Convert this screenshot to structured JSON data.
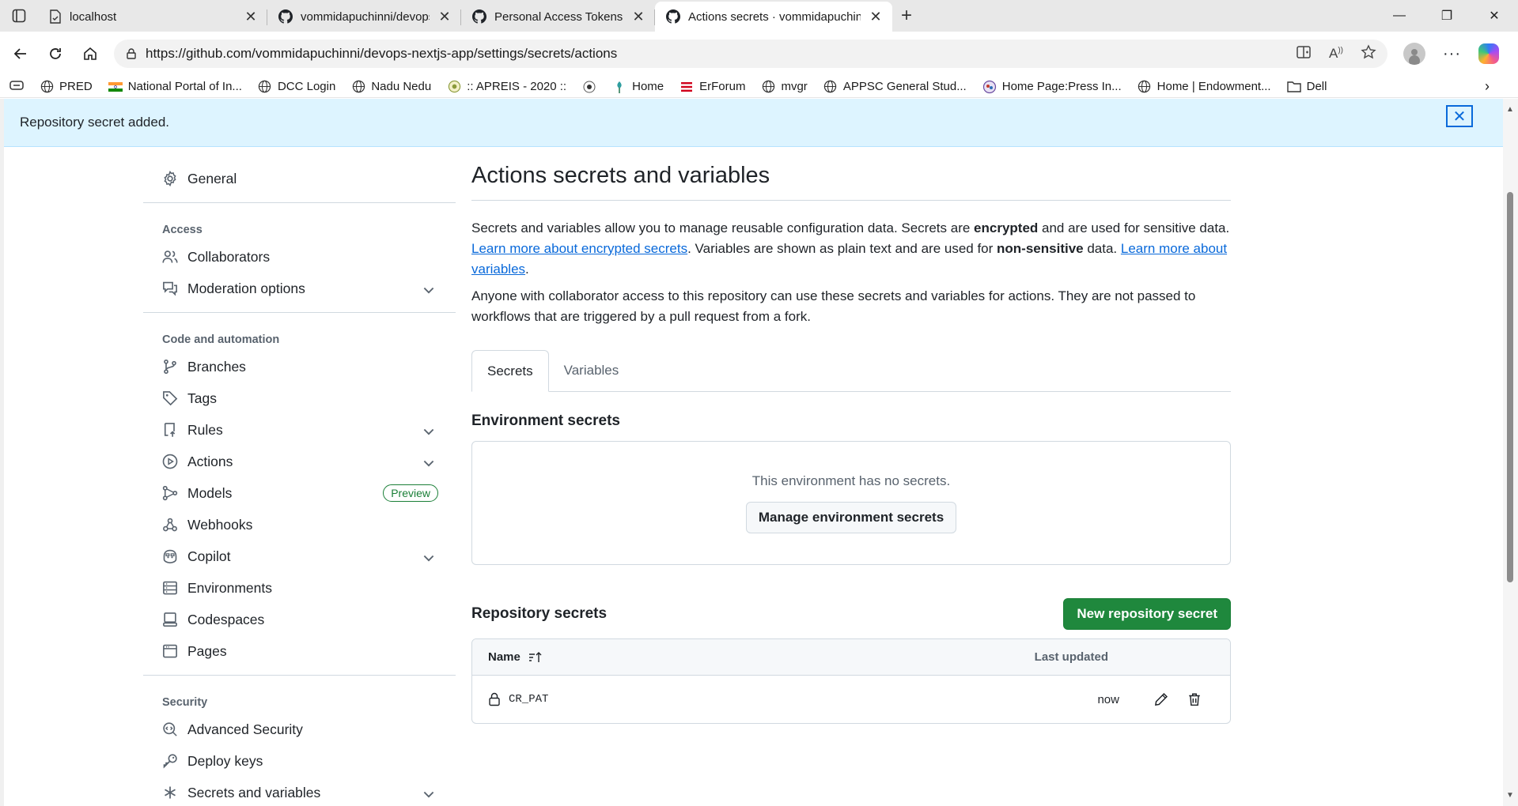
{
  "browser": {
    "tabs": [
      {
        "title": "localhost"
      },
      {
        "title": "vommidapuchinni/devops-nextjs-"
      },
      {
        "title": "Personal Access Tokens (Classic)"
      },
      {
        "title": "Actions secrets · vommidapuchinn"
      }
    ],
    "url": "https://github.com/vommidapuchinni/devops-nextjs-app/settings/secrets/actions",
    "bookmarks": [
      "PRED",
      "National Portal of In...",
      "DCC Login",
      "Nadu Nedu",
      ":: APREIS - 2020 ::",
      "Home",
      "ErForum",
      "mvgr",
      "APPSC General Stud...",
      "Home Page:Press In...",
      "Home | Endowment...",
      "Dell"
    ]
  },
  "flash": {
    "message": "Repository secret added."
  },
  "sidebar": {
    "general": "General",
    "access_heading": "Access",
    "collaborators": "Collaborators",
    "moderation": "Moderation options",
    "code_heading": "Code and automation",
    "branches": "Branches",
    "tags": "Tags",
    "rules": "Rules",
    "actions": "Actions",
    "models": "Models",
    "models_badge": "Preview",
    "webhooks": "Webhooks",
    "copilot": "Copilot",
    "environments": "Environments",
    "codespaces": "Codespaces",
    "pages": "Pages",
    "security_heading": "Security",
    "advanced_security": "Advanced Security",
    "deploy_keys": "Deploy keys",
    "secrets_variables": "Secrets and variables"
  },
  "main": {
    "title": "Actions secrets and variables",
    "intro": {
      "t1": "Secrets and variables allow you to manage reusable configuration data. Secrets are ",
      "b1": "encrypted",
      "t2": " and are used for sensitive data. ",
      "link1": "Learn more about encrypted secrets",
      "t3": ". Variables are shown as plain text and are used for ",
      "b2": "non-sensitive",
      "t4": " data. ",
      "link2": "Learn more about variables",
      "t5": "."
    },
    "note": "Anyone with collaborator access to this repository can use these secrets and variables for actions. They are not passed to workflows that are triggered by a pull request from a fork.",
    "tabs": [
      "Secrets",
      "Variables"
    ],
    "env_heading": "Environment secrets",
    "env_empty": "This environment has no secrets.",
    "env_button": "Manage environment secrets",
    "repo_heading": "Repository secrets",
    "new_secret_button": "New repository secret",
    "table": {
      "col_name": "Name",
      "col_updated": "Last updated",
      "rows": [
        {
          "name": "CR_PAT",
          "updated": "now"
        }
      ]
    }
  }
}
